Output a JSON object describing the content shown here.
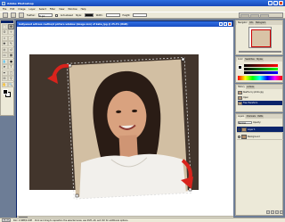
{
  "app": {
    "title": "Adobe Photoshop",
    "colors": {
      "title_bar": "#1748b8",
      "chrome": "#ece9d8",
      "workspace": "#6d7d96"
    }
  },
  "menu": {
    "items": [
      "File",
      "Edit",
      "Image",
      "Layer",
      "Select",
      "Filter",
      "View",
      "Window",
      "Help"
    ]
  },
  "options_bar": {
    "feather_label": "Feather:",
    "feather_value": "0 px",
    "antialias_label": "Anti-aliased",
    "style_label": "Style:",
    "style_value": "Normal",
    "width_label": "Width:",
    "height_label": "Height:"
  },
  "document": {
    "title": "bollywood actress reethu(d picture window (image mm) of kaha_lpg @ 25.4% (RGB)",
    "zoom": "25.4%",
    "status": "Doc: 2.46M/2.42M"
  },
  "navigator": {
    "tabs": [
      "Navigator",
      "Info",
      "Histogram"
    ]
  },
  "color_panel": {
    "tabs": [
      "Color",
      "Swatches",
      "Styles"
    ]
  },
  "history": {
    "tabs": [
      "History",
      "Actions"
    ],
    "items": [
      "Reethu lcy photo.jpg",
      "Open",
      "Free Transform"
    ],
    "selected_index": 2
  },
  "layers": {
    "tabs": [
      "Layers",
      "Channels",
      "Paths"
    ],
    "blend_mode": "Normal",
    "opacity_label": "Opacity:",
    "rows": [
      {
        "name": "Layer 1",
        "selected": true
      },
      {
        "name": "Background",
        "selected": false
      }
    ]
  },
  "statusbar": {
    "zoom": "25.4%",
    "doc": "Doc: 2.46M/2.42M",
    "hint": "Click and drag to reposition the selected area; use Shift, Alt, and Ctrl for additional options."
  },
  "tools": {
    "icons": [
      "marquee-icon",
      "move-icon",
      "lasso-icon",
      "magic-wand-icon",
      "crop-icon",
      "slice-icon",
      "healing-brush-icon",
      "brush-icon",
      "clone-stamp-icon",
      "history-brush-icon",
      "eraser-icon",
      "gradient-icon",
      "blur-icon",
      "dodge-icon",
      "path-selection-icon",
      "type-icon",
      "pen-icon",
      "shape-icon",
      "notes-icon",
      "eyedropper-icon",
      "hand-icon",
      "zoom-icon"
    ],
    "glyphs": [
      "⬚",
      "✥",
      "ʘ",
      "✧",
      "⌗",
      "⟋",
      "✚",
      "✎",
      "⎆",
      "↺",
      "▭",
      "▦",
      "💧",
      "●",
      "➤",
      "T",
      "✒",
      "▢",
      "✉",
      "⚲",
      "✋",
      "🔍"
    ],
    "active_index": 1
  },
  "canvas": {
    "rotate_arrow_color": "#d8231c",
    "selection_color": "#dddddd"
  }
}
